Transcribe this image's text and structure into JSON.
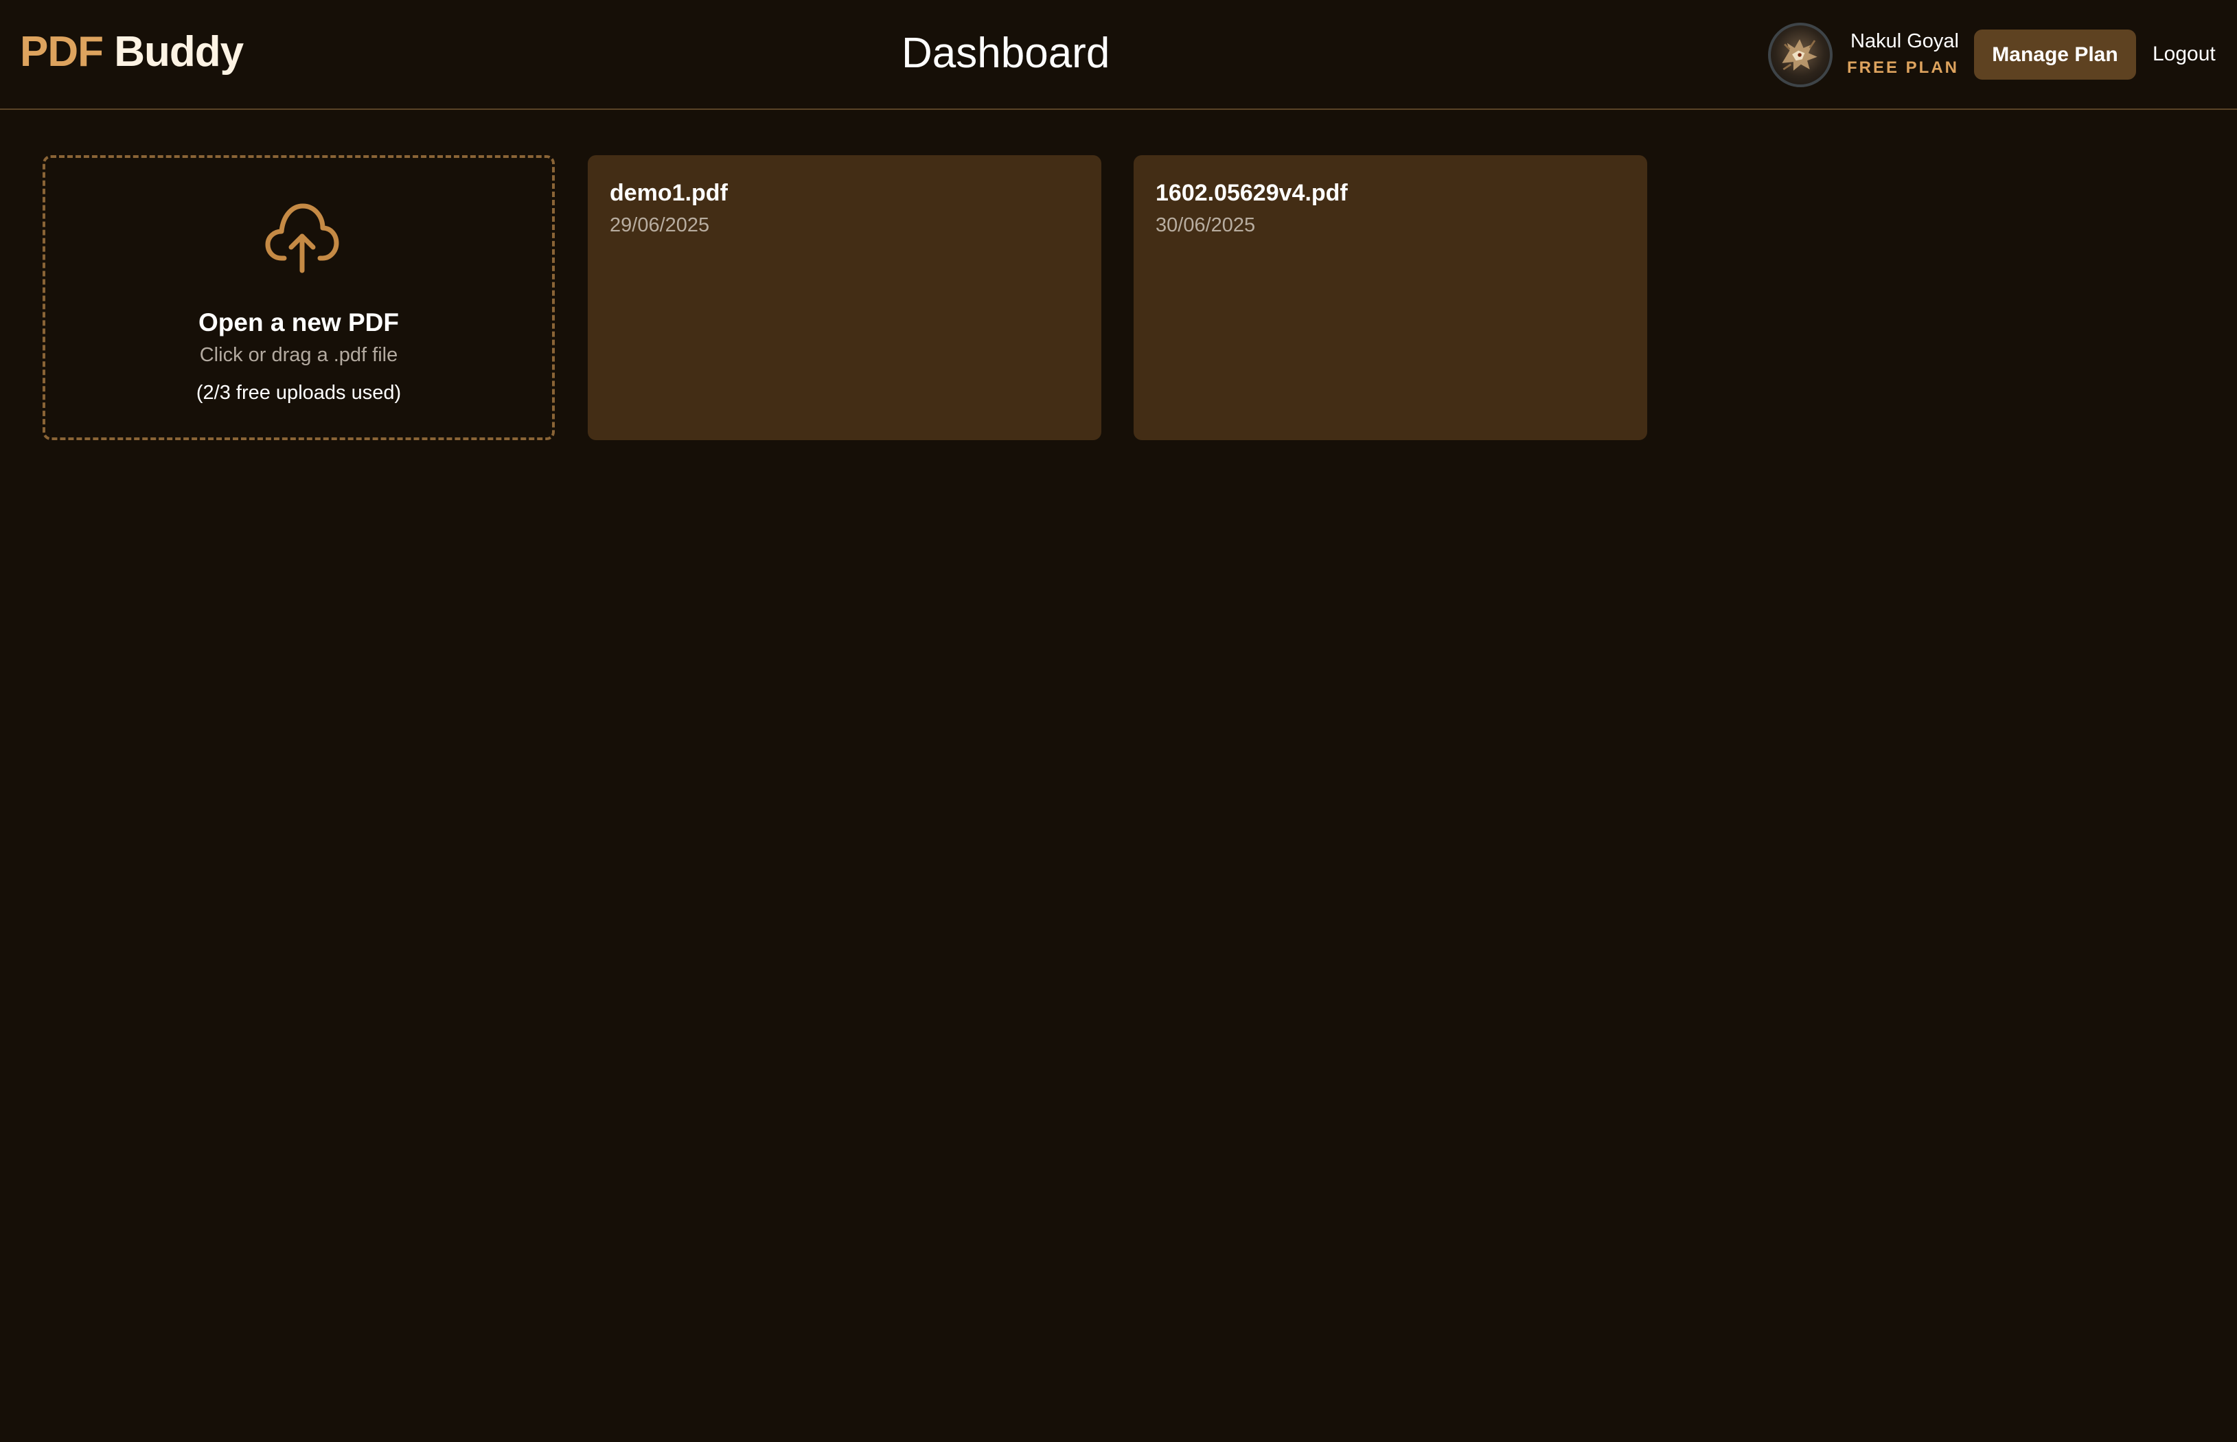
{
  "app": {
    "logo_accent": "PDF",
    "logo_main": " Buddy"
  },
  "header": {
    "title": "Dashboard",
    "user_name": "Nakul Goyal",
    "user_plan": "FREE PLAN",
    "manage_label": "Manage Plan",
    "logout_label": "Logout",
    "avatar_icon": "dragon-avatar"
  },
  "upload": {
    "icon": "cloud-upload-icon",
    "title": "Open a new PDF",
    "subtitle": "Click or drag a .pdf file",
    "usage": "(2/3 free uploads used)"
  },
  "documents": [
    {
      "name": "demo1.pdf",
      "date": "29/06/2025"
    },
    {
      "name": "1602.05629v4.pdf",
      "date": "30/06/2025"
    }
  ],
  "colors": {
    "background": "#160f07",
    "accent": "#dda35e",
    "card": "#432d15",
    "button": "#5e4221",
    "dashed_border": "#8a6436"
  }
}
